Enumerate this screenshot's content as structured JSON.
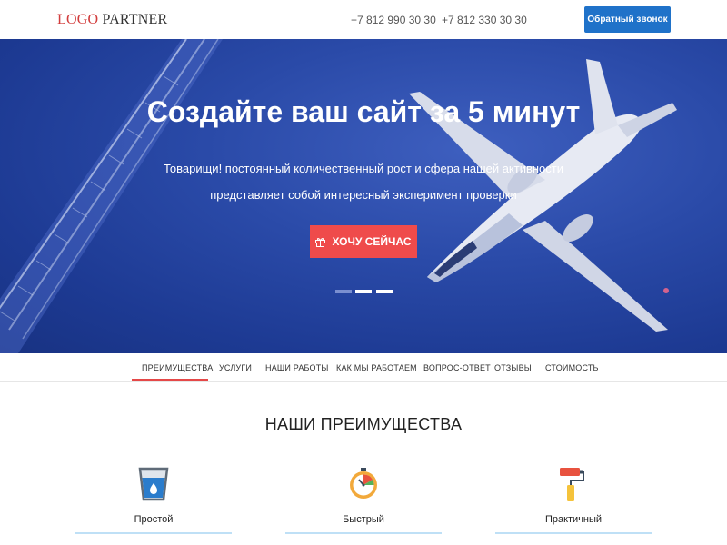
{
  "header": {
    "logo_part1": "LOGO",
    "logo_part2": "PARTNER",
    "phone1": "+7 812 990 30 30",
    "phone2": "+7 812 330 30 30",
    "callback_label": "Обратный звонок"
  },
  "hero": {
    "title": "Создайте ваш сайт за 5 минут",
    "subtitle_line1": "Товарищи! постоянный количественный рост и сфера нашей активности",
    "subtitle_line2": "представляет собой интересный эксперимент проверки",
    "cta_label": "ХОЧУ СЕЙЧАС",
    "slides_count": 3,
    "active_slide": 1
  },
  "nav": {
    "items": [
      {
        "label": "ПРЕИМУЩЕСТВА",
        "active": true
      },
      {
        "label": "УСЛУГИ"
      },
      {
        "label": "НАШИ РАБОТЫ"
      },
      {
        "label": "КАК МЫ РАБОТАЕМ"
      },
      {
        "label": "ВОПРОС-ОТВЕТ"
      },
      {
        "label": "ОТЗЫВЫ"
      },
      {
        "label": "СТОИМОСТЬ"
      }
    ]
  },
  "features": {
    "title": "НАШИ ПРЕИМУЩЕСТВА",
    "items": [
      {
        "label": "Простой",
        "icon": "water-glass-icon"
      },
      {
        "label": "Быстрый",
        "icon": "stopwatch-icon"
      },
      {
        "label": "Практичный",
        "icon": "paint-roller-icon"
      }
    ]
  },
  "colors": {
    "accent_blue": "#1f72c9",
    "accent_red": "#ef4b4b",
    "hero_bg": "#2a4aa8"
  }
}
